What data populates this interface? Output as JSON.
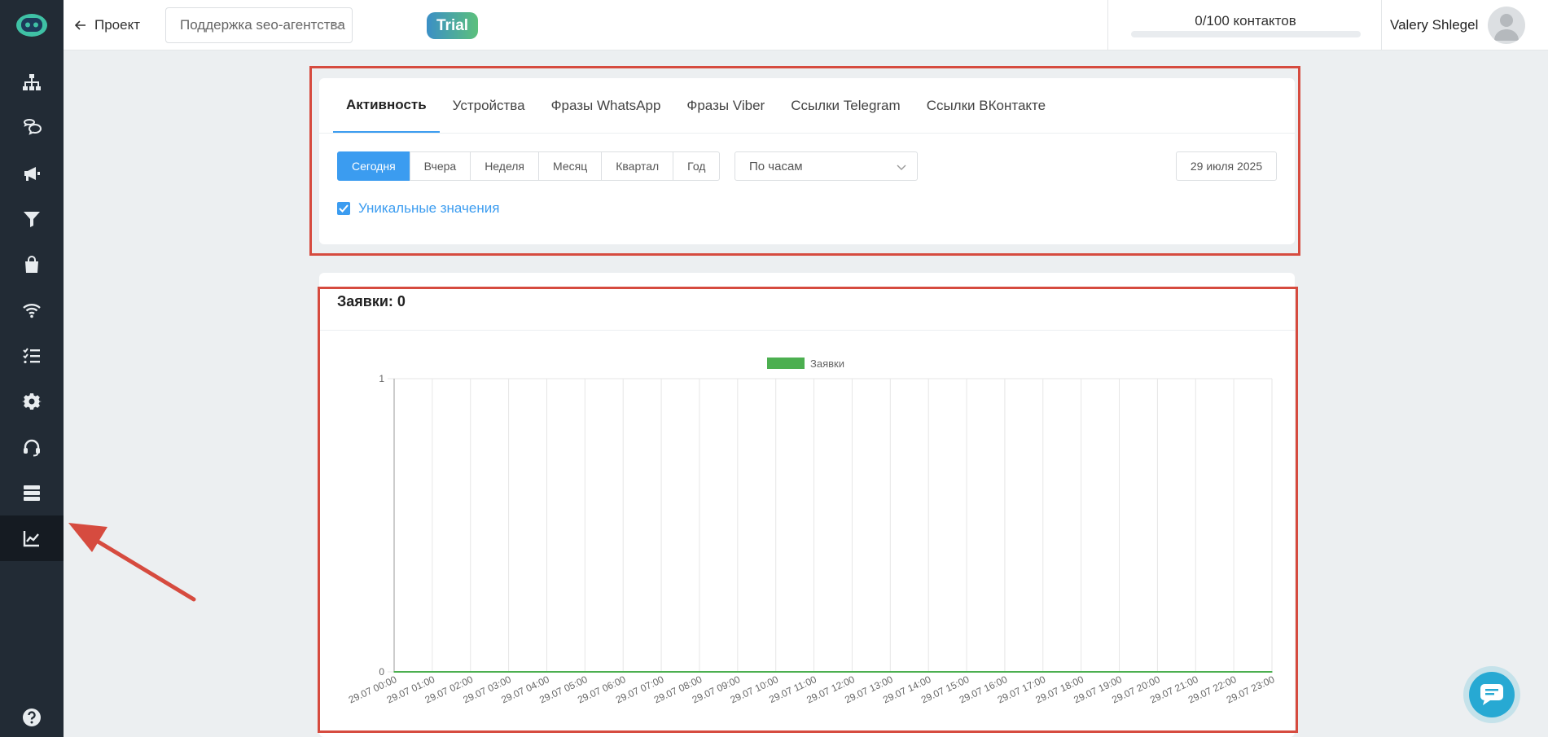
{
  "header": {
    "back_label": "Проект",
    "project_value": "Поддержка seo-агентства",
    "trial_label": "Trial",
    "contacts_text": "0/100 контактов",
    "contacts_progress": 0,
    "user_name": "Valery Shlegel"
  },
  "sidebar": {
    "items": [
      {
        "icon": "sitemap-icon"
      },
      {
        "icon": "chat-bubbles-icon"
      },
      {
        "icon": "megaphone-icon"
      },
      {
        "icon": "filter-icon"
      },
      {
        "icon": "shopping-bag-icon"
      },
      {
        "icon": "wifi-icon"
      },
      {
        "icon": "checklist-icon"
      },
      {
        "icon": "gear-icon"
      },
      {
        "icon": "headset-icon"
      },
      {
        "icon": "server-icon"
      },
      {
        "icon": "chart-line-icon",
        "active": true
      },
      {
        "icon": "help-icon"
      }
    ]
  },
  "filters": {
    "tabs": [
      "Активность",
      "Устройства",
      "Фразы WhatsApp",
      "Фразы Viber",
      "Ссылки Telegram",
      "Ссылки ВКонтакте"
    ],
    "active_tab": "Активность",
    "periods": [
      "Сегодня",
      "Вчера",
      "Неделя",
      "Месяц",
      "Квартал",
      "Год"
    ],
    "active_period": "Сегодня",
    "granularity": "По часам",
    "date": "29 июля 2025",
    "unique_label": "Уникальные значения",
    "unique_checked": true
  },
  "chart_card": {
    "title": "Заявки: 0"
  },
  "colors": {
    "accent": "#3b9cf0",
    "series": "#4caf50",
    "sidebar": "#222b35",
    "annotation": "#d64b3f"
  },
  "chart_data": {
    "type": "line",
    "x": [
      "29.07 00:00",
      "29.07 01:00",
      "29.07 02:00",
      "29.07 03:00",
      "29.07 04:00",
      "29.07 05:00",
      "29.07 06:00",
      "29.07 07:00",
      "29.07 08:00",
      "29.07 09:00",
      "29.07 10:00",
      "29.07 11:00",
      "29.07 12:00",
      "29.07 13:00",
      "29.07 14:00",
      "29.07 15:00",
      "29.07 16:00",
      "29.07 17:00",
      "29.07 18:00",
      "29.07 19:00",
      "29.07 20:00",
      "29.07 21:00",
      "29.07 22:00",
      "29.07 23:00"
    ],
    "series": [
      {
        "name": "Заявки",
        "values": [
          0,
          0,
          0,
          0,
          0,
          0,
          0,
          0,
          0,
          0,
          0,
          0,
          0,
          0,
          0,
          0,
          0,
          0,
          0,
          0,
          0,
          0,
          0,
          0
        ]
      }
    ],
    "ylim": [
      0,
      1
    ],
    "yticks": [
      0,
      1
    ],
    "grid": true,
    "legend": "top-center"
  }
}
